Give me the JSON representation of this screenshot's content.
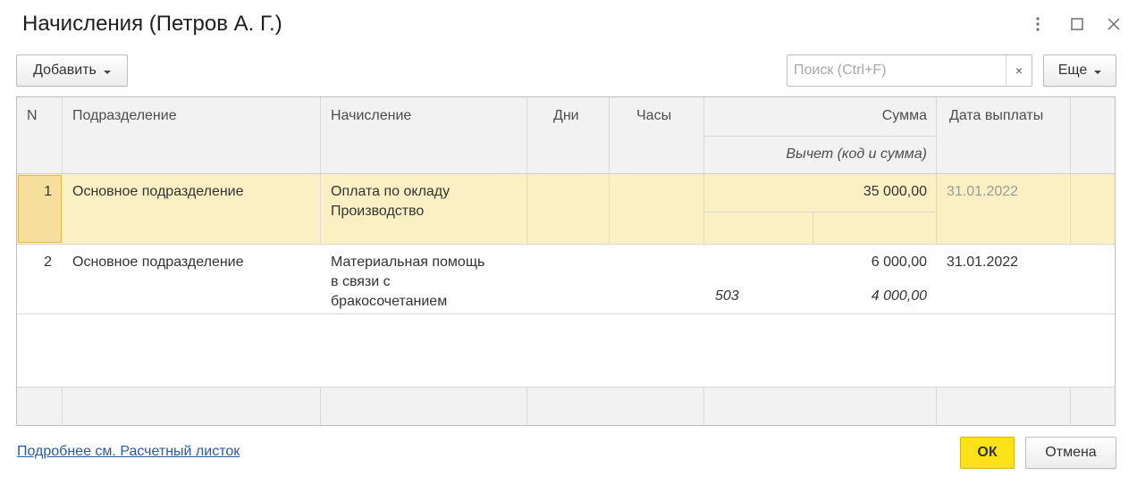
{
  "window": {
    "title": "Начисления (Петров А. Г.)"
  },
  "toolbar": {
    "add_label": "Добавить",
    "search_placeholder": "Поиск (Ctrl+F)",
    "clear_label": "×",
    "more_label": "Еще"
  },
  "table": {
    "headers": {
      "n": "N",
      "department": "Подразделение",
      "accrual": "Начисление",
      "days": "Дни",
      "hours": "Часы",
      "amount": "Сумма",
      "deduction": "Вычет (код и сумма)",
      "pay_date": "Дата выплаты"
    },
    "rows": [
      {
        "n": "1",
        "department": "Основное подразделение",
        "accrual_line1": "Оплата по окладу",
        "accrual_line2": "Производство",
        "accrual_line3": "",
        "days": "",
        "hours": "",
        "amount": "35 000,00",
        "deduction_code": "",
        "deduction_amount": "",
        "pay_date": "31.01.2022"
      },
      {
        "n": "2",
        "department": "Основное подразделение",
        "accrual_line1": "Материальная помощь",
        "accrual_line2": "в связи с",
        "accrual_line3": "бракосочетанием",
        "days": "",
        "hours": "",
        "amount": "6 000,00",
        "deduction_code": "503",
        "deduction_amount": "4 000,00",
        "pay_date": "31.01.2022"
      }
    ]
  },
  "footer": {
    "details_link": "Подробнее см. Расчетный листок",
    "ok_label": "ОК",
    "cancel_label": "Отмена"
  },
  "colors": {
    "selected_row": "#fbf0c4",
    "header_bg": "#f2f2f2",
    "ok_button": "#ffe11a",
    "link": "#2a5a9e"
  }
}
